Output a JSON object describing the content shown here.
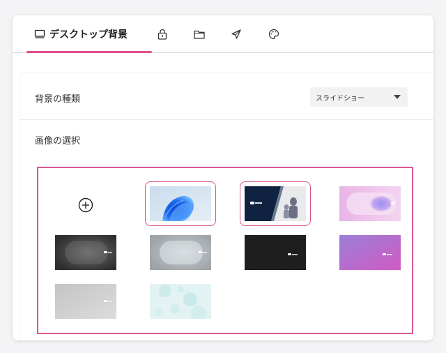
{
  "tabs": {
    "active_label": "デスクトップ背景",
    "icons": [
      "monitor-icon",
      "lock-icon",
      "folder-icon",
      "send-icon",
      "palette-icon"
    ]
  },
  "background": {
    "type_label": "背景の種類",
    "type_value": "スライドショー",
    "image_select_label": "画像の選択"
  },
  "wallpapers": {
    "brand_text": "LAVIE",
    "items": [
      {
        "name": "windows-bloom",
        "selected": true
      },
      {
        "name": "lavie-dark-blue-anime",
        "selected": true
      },
      {
        "name": "pink-gradient",
        "selected": false
      },
      {
        "name": "dark-gray-gradient",
        "selected": false
      },
      {
        "name": "silver-gradient",
        "selected": false
      },
      {
        "name": "black-texture",
        "selected": false
      },
      {
        "name": "purple-gradient",
        "selected": false
      },
      {
        "name": "light-gray",
        "selected": false
      },
      {
        "name": "mint-bubbles",
        "selected": false
      }
    ]
  },
  "colors": {
    "accent": "#e0508a",
    "border_pink": "#d9558f"
  }
}
